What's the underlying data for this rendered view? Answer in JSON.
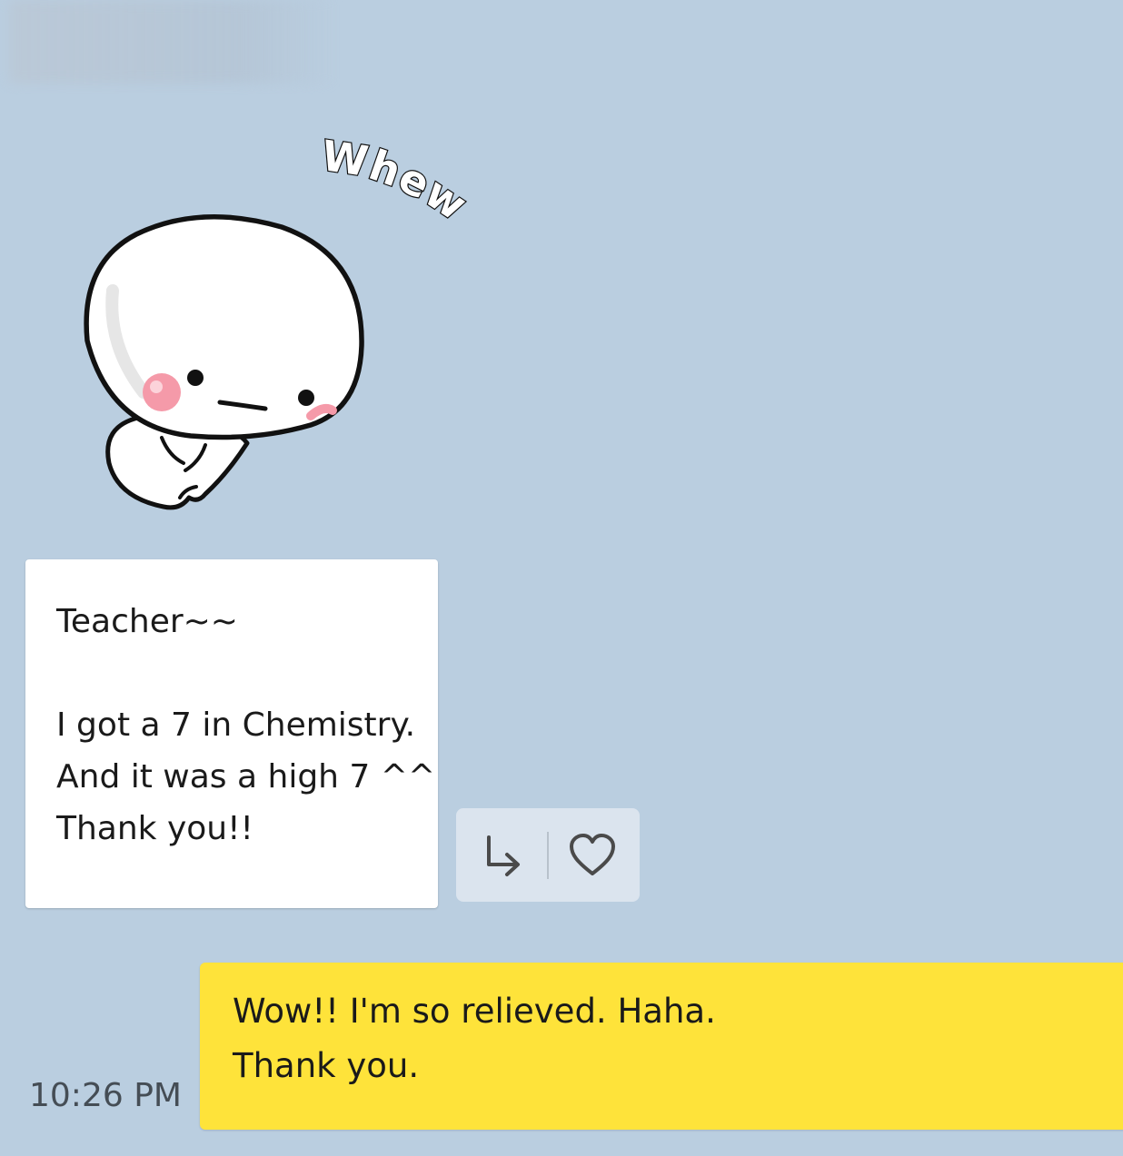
{
  "sticker": {
    "text": "Whew"
  },
  "incoming_message": {
    "lines": [
      "Teacher~~",
      "",
      "I got a 7 in Chemistry.",
      "And it was a high 7 ^^",
      "Thank you!!"
    ]
  },
  "reactions": {
    "reply_icon": "reply-arrow-icon",
    "like_icon": "heart-icon"
  },
  "outgoing_message": {
    "time": "10:26 PM",
    "lines": [
      "Wow!! I'm so relieved. Haha.",
      "Thank you."
    ]
  },
  "colors": {
    "background": "#bacee0",
    "incoming_bubble": "#ffffff",
    "outgoing_bubble": "#fee33a",
    "reaction_bar": "#dbe4ee"
  }
}
